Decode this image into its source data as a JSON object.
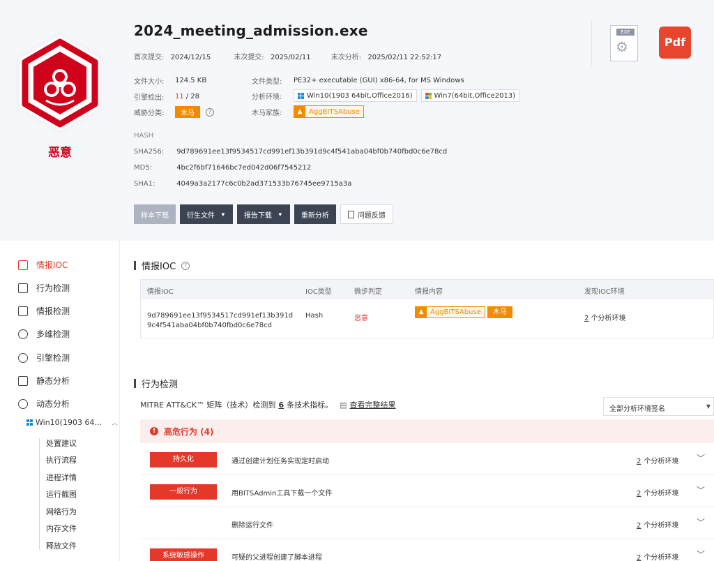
{
  "file": {
    "name": "2024_meeting_admission.exe",
    "verdict": "恶意",
    "first_submit_label": "首次提交:",
    "first_submit": "2024/12/15",
    "last_submit_label": "末次提交:",
    "last_submit": "2025/02/11",
    "last_analysis_label": "末次分析:",
    "last_analysis": "2025/02/11 22:52:17",
    "size_label": "文件大小:",
    "size": "124.5 KB",
    "type_label": "文件类型:",
    "type": "PE32+ executable (GUI) x86-64, for MS Windows",
    "engine_label": "引擎检出:",
    "engine_hits": "11",
    "engine_total": "/ 28",
    "env_label": "分析环境:",
    "env1": "Win10(1903 64bit,Office2016)",
    "env2": "Win7(64bit,Office2013)",
    "threat_label": "威胁分类:",
    "threat_tag": "木马",
    "family_label": "木马家族:",
    "family": "AggBITSAbuse"
  },
  "hash": {
    "title": "HASH",
    "sha256_label": "SHA256:",
    "sha256": "9d789691ee13f9534517cd991ef13b391d9c4f541aba04bf0b740fbd0c6e78cd",
    "md5_label": "MD5:",
    "md5": "4bc2f6bf71646bc7ed042d06f7545212",
    "sha1_label": "SHA1:",
    "sha1": "4049a3a2177c6c0b2ad371533b76745ee9715a3a"
  },
  "buttons": {
    "download_sample": "样本下载",
    "derived_files": "衍生文件",
    "report_download": "报告下载",
    "reanalyze": "重新分析",
    "feedback": "问题反馈"
  },
  "file_icons": {
    "exe_caption": "EXE",
    "pdf_label": "Pdf"
  },
  "sidebar": {
    "items": [
      "情报IOC",
      "行为检测",
      "情报检测",
      "多维检测",
      "引擎检测",
      "静态分析",
      "动态分析"
    ],
    "env_sub": "Win10(1903 64...",
    "tree": [
      "处置建议",
      "执行流程",
      "进程详情",
      "运行截图",
      "网络行为",
      "内存文件",
      "释放文件"
    ]
  },
  "ioc": {
    "title": "情报IOC",
    "headers": [
      "情报IOC",
      "IOC类型",
      "微步判定",
      "情报内容",
      "发现IOC环境"
    ],
    "row": {
      "ioc_line1": "9d789691ee13f9534517cd991ef13b391d",
      "ioc_line2": "9c4f541aba04bf0b740fbd0c6e78cd",
      "type": "Hash",
      "verdict": "恶意",
      "family": "AggBITSAbuse",
      "tag": "木马",
      "env_count": "2",
      "env_text": "个分析环境"
    }
  },
  "behavior": {
    "title": "行为检测",
    "mitre_prefix": "MITRE ATT&CK™ 矩阵（技术）检测到",
    "mitre_count": "6",
    "mitre_suffix": "条技术指标。",
    "view_full": "查看完整结果",
    "filter_value": "全部分析环境签名",
    "risk_title": "高危行为 (4)",
    "rows": [
      {
        "tag": "持久化",
        "desc": "通过创建计划任务实现定时启动",
        "count": "2",
        "env": "个分析环境"
      },
      {
        "tag": "一般行为",
        "desc": "用BITSAdmin工具下载一个文件",
        "count": "2",
        "env": "个分析环境"
      },
      {
        "tag": "",
        "desc": "删除运行文件",
        "count": "2",
        "env": "个分析环境"
      },
      {
        "tag": "系统敏感操作",
        "desc": "可疑的父进程创建了脚本进程",
        "count": "2",
        "env": "个分析环境"
      }
    ]
  },
  "colors": {
    "danger": "#e4382b",
    "orange": "#f28b00",
    "dark_button": "#3c4353"
  }
}
